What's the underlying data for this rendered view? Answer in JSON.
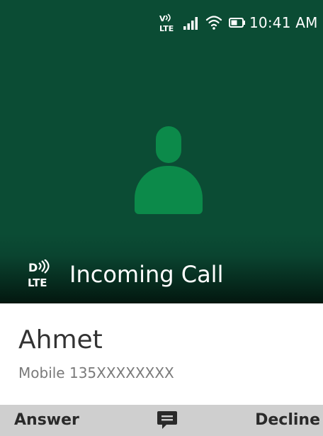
{
  "status_bar": {
    "time": "10:41 AM",
    "icons": [
      "volte-icon",
      "signal-icon",
      "wifi-icon",
      "battery-icon"
    ]
  },
  "call": {
    "state_label": "Incoming Call",
    "state_icon": "volte-call-icon",
    "caller_name": "Ahmet",
    "caller_number": "Mobile 135XXXXXXXX"
  },
  "softkeys": {
    "left": "Answer",
    "center_icon": "message-icon",
    "right": "Decline"
  },
  "colors": {
    "background": "#0b4c34",
    "avatar": "#0c8a4a",
    "softkey_bar": "#cfcfcf"
  }
}
